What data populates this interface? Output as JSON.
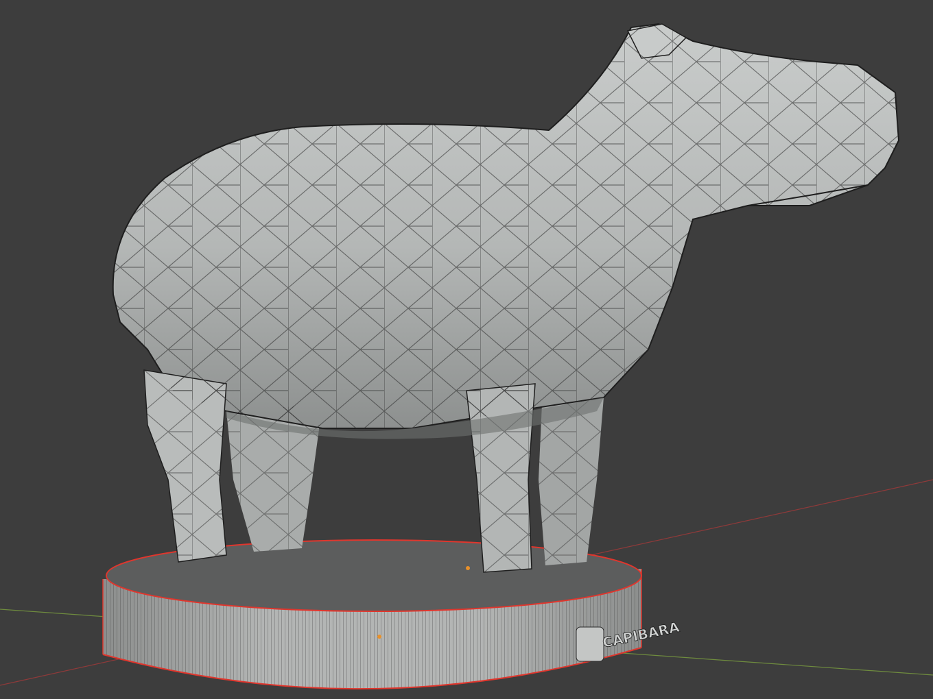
{
  "viewport": {
    "background_color": "#3d3d3d",
    "grid_x_axis_color": "#8f3a3a",
    "grid_y_axis_color": "#6f8c3e",
    "selection_outline_color": "#e0362d",
    "origin_dot_color": "#e8902a"
  },
  "model": {
    "body_color": "#b6b9b8",
    "edge_color": "#1e1e1e",
    "base_color": "#a7a9a8",
    "base_top_color": "#5a5b5b",
    "label_text": "CAPIBARA"
  }
}
